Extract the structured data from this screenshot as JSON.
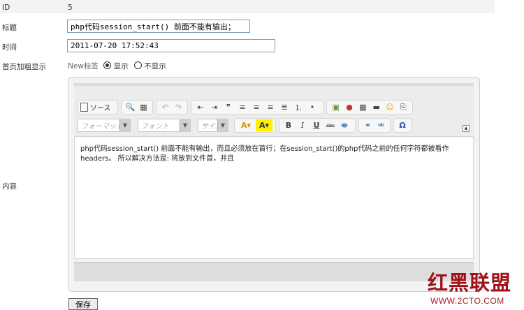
{
  "fields": {
    "id_label": "ID",
    "id_value": "5",
    "title_label": "标题",
    "title_value": "php代码session_start() 前面不能有输出；",
    "time_label": "时间",
    "time_value": "2011-07-20 17:52:43",
    "homepage_label": "首页加粗显示",
    "new_tag_label": "New标签",
    "option_show": "显示",
    "option_hide": "不显示",
    "selected_option": "显示",
    "content_label": "内容"
  },
  "editor": {
    "source_label": "ソース",
    "format_combo": "フォーマット",
    "font_combo": "フォント",
    "size_combo": "サイ.",
    "content_text": "php代码session_start() 前面不能有输出，而且必须放在首行；在session_start()的php代码之前的任何字符都被看作headers。 所以解决方法是: 将放到文件首，并且"
  },
  "buttons": {
    "save": "保存"
  },
  "watermark": {
    "logo_text": "红黑联盟",
    "url": "WWW.2CTO.COM"
  }
}
